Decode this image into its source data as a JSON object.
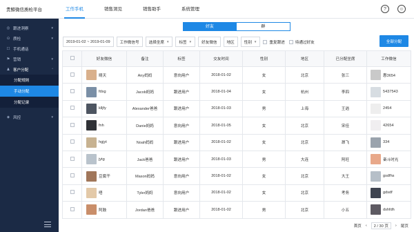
{
  "app": {
    "title": "贵鲸微信质检平台"
  },
  "topnav": [
    {
      "label": "工作手机",
      "active": true
    },
    {
      "label": "销售洞见",
      "active": false
    },
    {
      "label": "销售助手",
      "active": false
    },
    {
      "label": "系统管理",
      "active": false
    }
  ],
  "header_icons": {
    "help": "?",
    "user": "☺"
  },
  "sidebar": {
    "items": [
      {
        "label": "跟进洞察",
        "icon": "◎",
        "has_chevron": true
      },
      {
        "label": "质检",
        "icon": "⊙",
        "has_chevron": true
      },
      {
        "label": "手机通话",
        "icon": "☐",
        "has_chevron": false
      },
      {
        "label": "营销",
        "icon": "⚑",
        "has_chevron": true
      }
    ],
    "open_group": {
      "label": "客户分配",
      "icon": "♟",
      "chevron": "⌃"
    },
    "sub_items": [
      {
        "label": "分配规则",
        "active": false
      },
      {
        "label": "手动分配",
        "active": true
      },
      {
        "label": "分配记录",
        "active": false
      }
    ],
    "after": {
      "label": "风控",
      "icon": "◈",
      "has_chevron": true
    }
  },
  "segments": [
    {
      "label": "好友",
      "active": true
    },
    {
      "label": "群",
      "active": false
    }
  ],
  "filters": {
    "date_range": "2019-01-02 ~ 2019-01-09",
    "selects": [
      "工作微信号",
      "选择坐席",
      "标签",
      "好友微信",
      "地区",
      "性别"
    ],
    "checkboxes": [
      "重复跟进",
      "待通过好友"
    ],
    "assign_all": "全部分配"
  },
  "table": {
    "headers": [
      "好友微信",
      "备注",
      "标签",
      "交友时间",
      "性别",
      "地区",
      "已分配坐席",
      "工作微信"
    ],
    "rows": [
      {
        "wx": "晴天",
        "note": "Any妈妈",
        "tag": "意向用户",
        "time": "2018-01-02",
        "gender": "女",
        "region": "北京",
        "agent": "张三",
        "work": "惠3654",
        "c1": "#d9b08c",
        "c2": "#c9c9c9"
      },
      {
        "wx": "fdsg",
        "note": "Jacob妈妈",
        "tag": "跟进用户",
        "time": "2018-01-04",
        "gender": "女",
        "region": "杭州",
        "agent": "李四",
        "work": "5437543",
        "c1": "#7a8fa6",
        "c2": "#d7dde2"
      },
      {
        "wx": "klljfy",
        "note": "Alexander爸爸",
        "tag": "跟进用户",
        "time": "2018-01-03",
        "gender": "男",
        "region": "上海",
        "agent": "王逍",
        "work": "2454",
        "c1": "#4d5561",
        "c2": "#eeeeee"
      },
      {
        "wx": "fnh",
        "note": "Danie妈妈",
        "tag": "意向用户",
        "time": "2018-01-05",
        "gender": "女",
        "region": "北京",
        "agent": "宋佳",
        "work": "42654",
        "c1": "#2f3136",
        "c2": "#f0eef0"
      },
      {
        "wx": "hgjyt",
        "note": "Noah妈妈",
        "tag": "跟进用户",
        "time": "2018-01-02",
        "gender": "女",
        "region": "北京",
        "agent": "昂飞",
        "work": "334",
        "c1": "#c7b291",
        "c2": "#9aa3ad"
      },
      {
        "wx": "jytg",
        "note": "Jack爸爸",
        "tag": "跟进用户",
        "time": "2018-01-03",
        "gender": "男",
        "region": "大连",
        "agent": "阿旺",
        "work": "奋斗时光",
        "c1": "#b9c3cc",
        "c2": "#e8a88a"
      },
      {
        "wx": "豆腐干",
        "note": "Mason妈妈",
        "tag": "意向用户",
        "time": "2018-01-02",
        "gender": "女",
        "region": "北京",
        "agent": "大王",
        "work": "gsdfhs",
        "c1": "#a0765a",
        "c2": "#b6bfc8"
      },
      {
        "wx": "唔",
        "note": "Tyler妈妈",
        "tag": "意向用户",
        "time": "2018-01-02",
        "gender": "女",
        "region": "北京",
        "agent": "考务",
        "work": "gdsdf",
        "c1": "#e3c9a8",
        "c2": "#3f4450"
      },
      {
        "wx": "阿鼓",
        "note": "Jordan爸爸",
        "tag": "跟进用户",
        "time": "2018-01-02",
        "gender": "男",
        "region": "北京",
        "agent": "小五",
        "work": "dshfdh",
        "c1": "#c98e6a",
        "c2": "#5d5a62"
      }
    ]
  },
  "pager": {
    "first": "首页",
    "prev": "‹",
    "page": "2 / 30 页",
    "next": "›",
    "last": "尾页"
  }
}
